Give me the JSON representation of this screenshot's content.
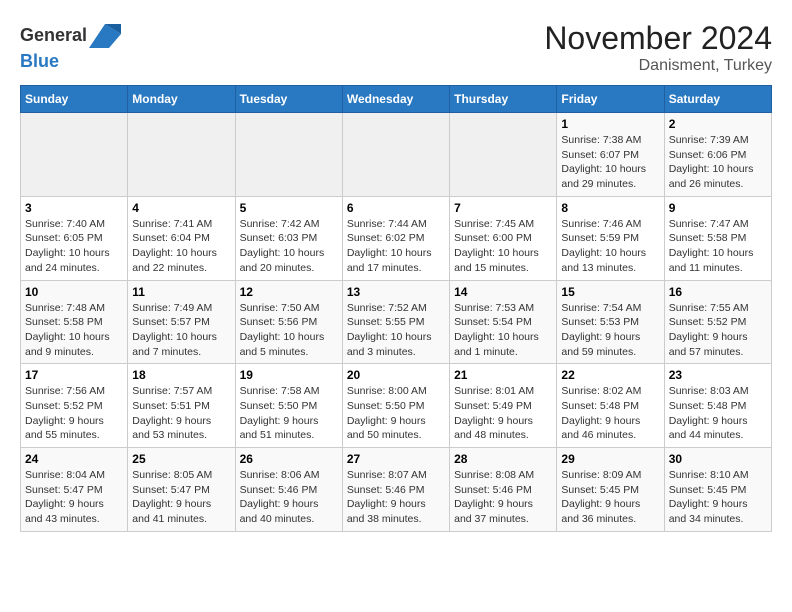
{
  "header": {
    "logo_line1": "General",
    "logo_line2": "Blue",
    "title": "November 2024",
    "subtitle": "Danisment, Turkey"
  },
  "weekdays": [
    "Sunday",
    "Monday",
    "Tuesday",
    "Wednesday",
    "Thursday",
    "Friday",
    "Saturday"
  ],
  "weeks": [
    [
      {
        "day": "",
        "info": ""
      },
      {
        "day": "",
        "info": ""
      },
      {
        "day": "",
        "info": ""
      },
      {
        "day": "",
        "info": ""
      },
      {
        "day": "",
        "info": ""
      },
      {
        "day": "1",
        "info": "Sunrise: 7:38 AM\nSunset: 6:07 PM\nDaylight: 10 hours and 29 minutes."
      },
      {
        "day": "2",
        "info": "Sunrise: 7:39 AM\nSunset: 6:06 PM\nDaylight: 10 hours and 26 minutes."
      }
    ],
    [
      {
        "day": "3",
        "info": "Sunrise: 7:40 AM\nSunset: 6:05 PM\nDaylight: 10 hours and 24 minutes."
      },
      {
        "day": "4",
        "info": "Sunrise: 7:41 AM\nSunset: 6:04 PM\nDaylight: 10 hours and 22 minutes."
      },
      {
        "day": "5",
        "info": "Sunrise: 7:42 AM\nSunset: 6:03 PM\nDaylight: 10 hours and 20 minutes."
      },
      {
        "day": "6",
        "info": "Sunrise: 7:44 AM\nSunset: 6:02 PM\nDaylight: 10 hours and 17 minutes."
      },
      {
        "day": "7",
        "info": "Sunrise: 7:45 AM\nSunset: 6:00 PM\nDaylight: 10 hours and 15 minutes."
      },
      {
        "day": "8",
        "info": "Sunrise: 7:46 AM\nSunset: 5:59 PM\nDaylight: 10 hours and 13 minutes."
      },
      {
        "day": "9",
        "info": "Sunrise: 7:47 AM\nSunset: 5:58 PM\nDaylight: 10 hours and 11 minutes."
      }
    ],
    [
      {
        "day": "10",
        "info": "Sunrise: 7:48 AM\nSunset: 5:58 PM\nDaylight: 10 hours and 9 minutes."
      },
      {
        "day": "11",
        "info": "Sunrise: 7:49 AM\nSunset: 5:57 PM\nDaylight: 10 hours and 7 minutes."
      },
      {
        "day": "12",
        "info": "Sunrise: 7:50 AM\nSunset: 5:56 PM\nDaylight: 10 hours and 5 minutes."
      },
      {
        "day": "13",
        "info": "Sunrise: 7:52 AM\nSunset: 5:55 PM\nDaylight: 10 hours and 3 minutes."
      },
      {
        "day": "14",
        "info": "Sunrise: 7:53 AM\nSunset: 5:54 PM\nDaylight: 10 hours and 1 minute."
      },
      {
        "day": "15",
        "info": "Sunrise: 7:54 AM\nSunset: 5:53 PM\nDaylight: 9 hours and 59 minutes."
      },
      {
        "day": "16",
        "info": "Sunrise: 7:55 AM\nSunset: 5:52 PM\nDaylight: 9 hours and 57 minutes."
      }
    ],
    [
      {
        "day": "17",
        "info": "Sunrise: 7:56 AM\nSunset: 5:52 PM\nDaylight: 9 hours and 55 minutes."
      },
      {
        "day": "18",
        "info": "Sunrise: 7:57 AM\nSunset: 5:51 PM\nDaylight: 9 hours and 53 minutes."
      },
      {
        "day": "19",
        "info": "Sunrise: 7:58 AM\nSunset: 5:50 PM\nDaylight: 9 hours and 51 minutes."
      },
      {
        "day": "20",
        "info": "Sunrise: 8:00 AM\nSunset: 5:50 PM\nDaylight: 9 hours and 50 minutes."
      },
      {
        "day": "21",
        "info": "Sunrise: 8:01 AM\nSunset: 5:49 PM\nDaylight: 9 hours and 48 minutes."
      },
      {
        "day": "22",
        "info": "Sunrise: 8:02 AM\nSunset: 5:48 PM\nDaylight: 9 hours and 46 minutes."
      },
      {
        "day": "23",
        "info": "Sunrise: 8:03 AM\nSunset: 5:48 PM\nDaylight: 9 hours and 44 minutes."
      }
    ],
    [
      {
        "day": "24",
        "info": "Sunrise: 8:04 AM\nSunset: 5:47 PM\nDaylight: 9 hours and 43 minutes."
      },
      {
        "day": "25",
        "info": "Sunrise: 8:05 AM\nSunset: 5:47 PM\nDaylight: 9 hours and 41 minutes."
      },
      {
        "day": "26",
        "info": "Sunrise: 8:06 AM\nSunset: 5:46 PM\nDaylight: 9 hours and 40 minutes."
      },
      {
        "day": "27",
        "info": "Sunrise: 8:07 AM\nSunset: 5:46 PM\nDaylight: 9 hours and 38 minutes."
      },
      {
        "day": "28",
        "info": "Sunrise: 8:08 AM\nSunset: 5:46 PM\nDaylight: 9 hours and 37 minutes."
      },
      {
        "day": "29",
        "info": "Sunrise: 8:09 AM\nSunset: 5:45 PM\nDaylight: 9 hours and 36 minutes."
      },
      {
        "day": "30",
        "info": "Sunrise: 8:10 AM\nSunset: 5:45 PM\nDaylight: 9 hours and 34 minutes."
      }
    ]
  ]
}
